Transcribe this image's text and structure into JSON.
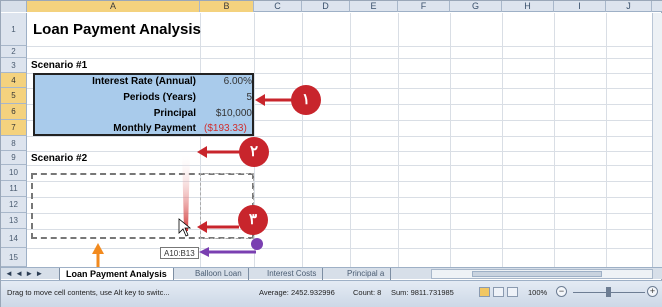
{
  "columns": [
    {
      "letter": "A",
      "active": true
    },
    {
      "letter": "B",
      "active": true
    },
    {
      "letter": "C",
      "active": false
    },
    {
      "letter": "D",
      "active": false
    },
    {
      "letter": "E",
      "active": false
    },
    {
      "letter": "F",
      "active": false
    },
    {
      "letter": "G",
      "active": false
    },
    {
      "letter": "H",
      "active": false
    },
    {
      "letter": "I",
      "active": false
    },
    {
      "letter": "J",
      "active": false
    }
  ],
  "rows": [
    "1",
    "2",
    "3",
    "4",
    "5",
    "6",
    "7",
    "8",
    "9",
    "10",
    "11",
    "12",
    "13",
    "14",
    "15"
  ],
  "cells": {
    "title": "Loan Payment Analysis",
    "scenario1": "Scenario #1",
    "rate_label": "Interest Rate (Annual)",
    "rate_value": "6.00%",
    "periods_label": "Periods (Years)",
    "periods_value": "5",
    "principal_label": "Principal",
    "principal_value": "$10,000",
    "payment_label": "Monthly Payment",
    "payment_value": "($193.33)",
    "scenario2": "Scenario #2"
  },
  "tooltip": "A10:B13",
  "callouts": [
    "١",
    "٢",
    "٣"
  ],
  "sheet_tabs": {
    "nav": "◄ ◄ ► ►",
    "active": "Loan Payment Analysis",
    "others": [
      "Balloon Loan",
      "Interest Costs",
      "Principal a"
    ]
  },
  "status": {
    "message": "Drag to move cell contents, use Alt key to switc...",
    "average": "Average: 2452.932996",
    "count": "Count: 8",
    "sum": "Sum: 9811.731985",
    "zoom": "100%",
    "zoom_minus": "−",
    "zoom_plus": "+"
  },
  "colors": {
    "selection_fill": "#a9cbeb",
    "callout_red": "#c8252c",
    "arrow_purple": "#7a3fb1",
    "arrow_orange": "#f28a1e",
    "negative_red": "#d12e2e"
  }
}
